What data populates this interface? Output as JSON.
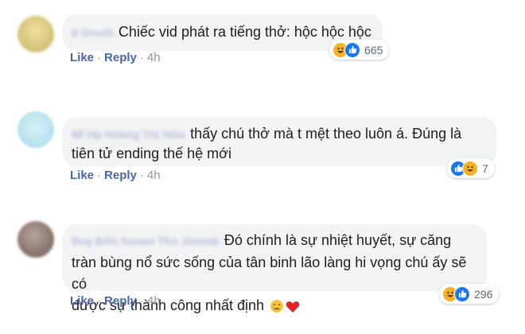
{
  "comments": [
    {
      "name": "Ii Grush",
      "text": "Chiếc vid phát ra tiếng thở: hộc hộc hộc",
      "like": "Like",
      "reply": "Reply",
      "time": "4h",
      "reaction_count": "665",
      "avatar_color": "#d8c989"
    },
    {
      "name": "Mĩ Hp Hoàng Thị Hữu",
      "text_line1": "thấy chú thở mà t mệt theo luôn á. Đúng là",
      "text_line2": "tiên tử ending thế hệ mới",
      "like": "Like",
      "reply": "Reply",
      "time": "4h",
      "reaction_count": "7",
      "avatar_color": "#bfe5f1"
    },
    {
      "name": "Boy Đốn Suoan Tho Jimmie",
      "text_line1": "Đó chính là sự nhiệt huyết, sự căng",
      "text_line2": "tràn bùng nổ sức sống của tân binh lão làng hi vọng chú ấy sẽ có",
      "text_line3": "được sự thành công nhất định",
      "like": "Like",
      "reply": "Reply",
      "time": "4h",
      "reaction_count": "296",
      "avatar_color": "#8e7a72"
    }
  ],
  "separator": "·",
  "icons": {
    "haha": "haha-reaction-icon",
    "like": "like-reaction-icon",
    "sad": "crying-emoji-icon",
    "heart": "heart-emoji-icon"
  }
}
